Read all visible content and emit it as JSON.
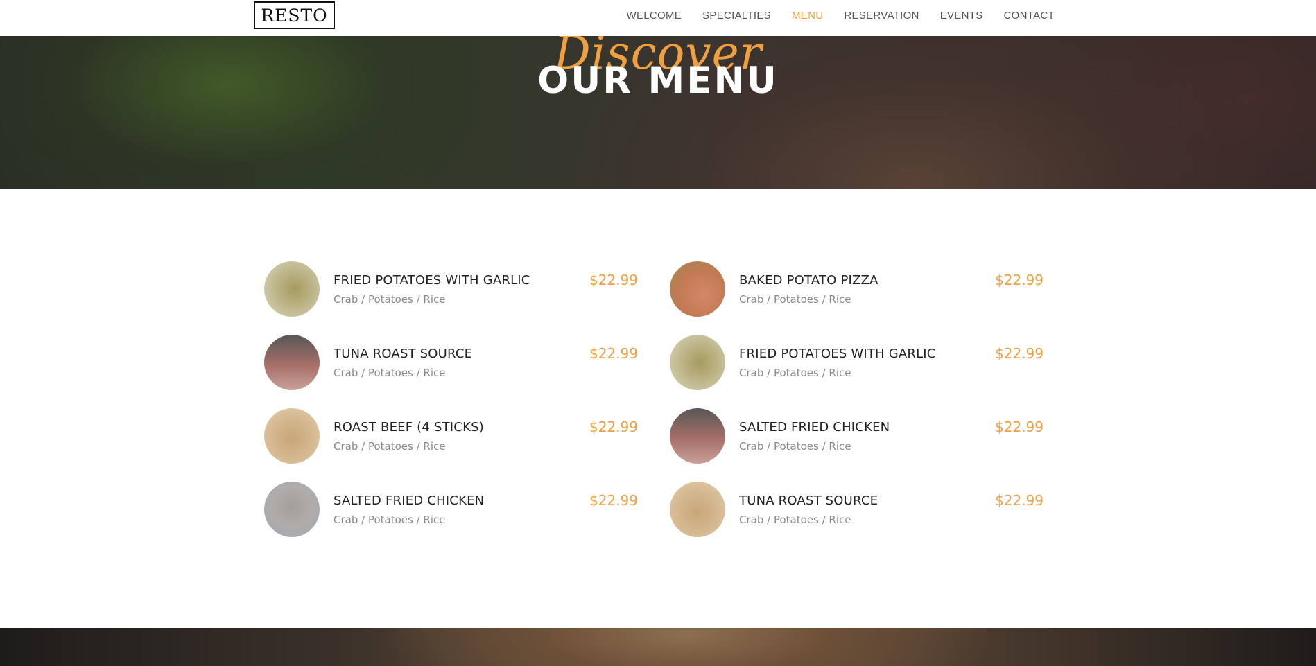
{
  "header": {
    "logo": "RESTO",
    "nav": [
      {
        "label": "WELCOME",
        "active": false
      },
      {
        "label": "SPECIALTIES",
        "active": false
      },
      {
        "label": "MENU",
        "active": true
      },
      {
        "label": "RESERVATION",
        "active": false
      },
      {
        "label": "EVENTS",
        "active": false
      },
      {
        "label": "CONTACT",
        "active": false
      }
    ]
  },
  "hero": {
    "script_text": "Discover",
    "title": "OUR MENU"
  },
  "menu": {
    "items": [
      {
        "name": "FRIED POTATOES WITH GARLIC",
        "desc": "Crab / Potatoes / Rice",
        "price": "$22.99"
      },
      {
        "name": "BAKED POTATO PIZZA",
        "desc": "Crab / Potatoes / Rice",
        "price": "$22.99"
      },
      {
        "name": "TUNA ROAST SOURCE",
        "desc": "Crab / Potatoes / Rice",
        "price": "$22.99"
      },
      {
        "name": "FRIED POTATOES WITH GARLIC",
        "desc": "Crab / Potatoes / Rice",
        "price": "$22.99"
      },
      {
        "name": "ROAST BEEF (4 STICKS)",
        "desc": "Crab / Potatoes / Rice",
        "price": "$22.99"
      },
      {
        "name": "SALTED FRIED CHICKEN",
        "desc": "Crab / Potatoes / Rice",
        "price": "$22.99"
      },
      {
        "name": "SALTED FRIED CHICKEN",
        "desc": "Crab / Potatoes / Rice",
        "price": "$22.99"
      },
      {
        "name": "TUNA ROAST SOURCE",
        "desc": "Crab / Potatoes / Rice",
        "price": "$22.99"
      }
    ]
  },
  "colors": {
    "accent": "#f0a040",
    "text_dark": "#222222",
    "text_muted": "#8a8a8a",
    "nav_text": "#555555"
  }
}
